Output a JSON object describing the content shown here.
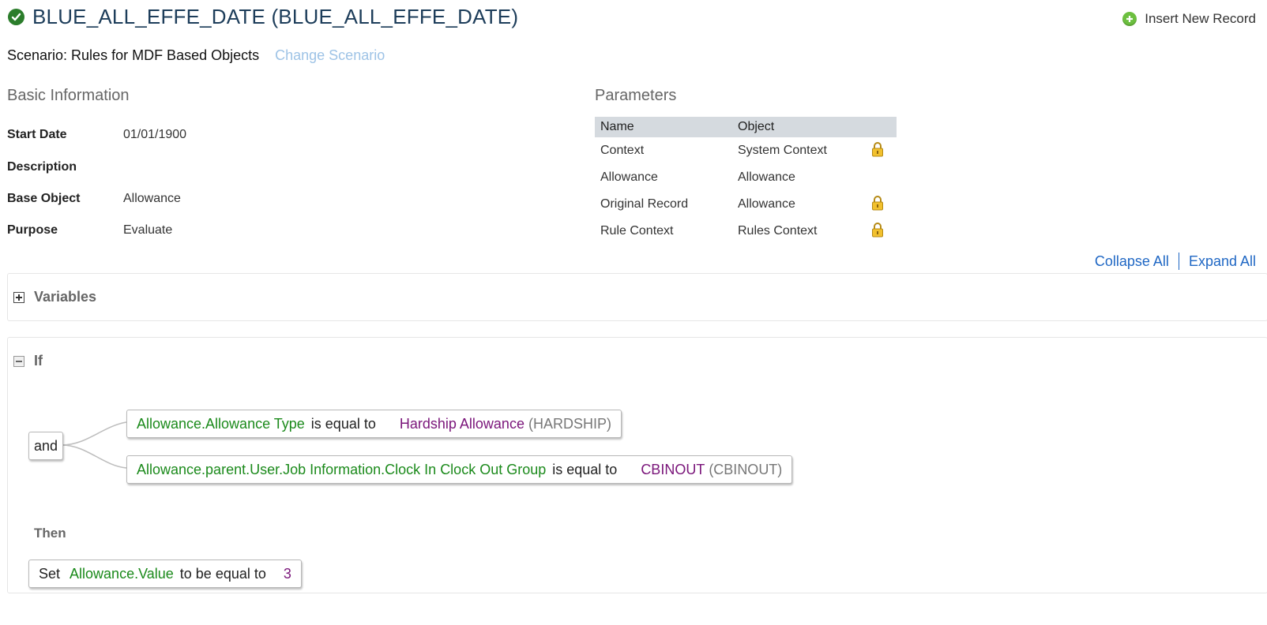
{
  "header": {
    "title": "BLUE_ALL_EFFE_DATE (BLUE_ALL_EFFE_DATE)",
    "status_icon": "check-circle-icon",
    "insert_label": "Insert New Record"
  },
  "scenario": {
    "label": "Scenario: Rules for MDF Based Objects",
    "change_label": "Change Scenario"
  },
  "basic_info": {
    "title": "Basic Information",
    "rows": [
      {
        "label": "Start Date",
        "value": "01/01/1900"
      },
      {
        "label": "Description",
        "value": ""
      },
      {
        "label": "Base Object",
        "value": "Allowance"
      },
      {
        "label": "Purpose",
        "value": "Evaluate"
      }
    ]
  },
  "parameters": {
    "title": "Parameters",
    "headers": [
      "Name",
      "Object"
    ],
    "rows": [
      {
        "name": "Context",
        "object": "System Context",
        "locked": true
      },
      {
        "name": "Allowance",
        "object": "Allowance",
        "locked": false
      },
      {
        "name": "Original Record",
        "object": "Allowance",
        "locked": true
      },
      {
        "name": "Rule Context",
        "object": "Rules Context",
        "locked": true
      }
    ]
  },
  "links": {
    "collapse": "Collapse All",
    "expand": "Expand All"
  },
  "variables": {
    "title": "Variables"
  },
  "if_section": {
    "title": "If",
    "operator": "and",
    "conditions": [
      {
        "field": "Allowance.Allowance Type",
        "op": "is equal to",
        "value": "Hardship Allowance",
        "code": "(HARDSHIP)"
      },
      {
        "field": "Allowance.parent.User.Job Information.Clock In Clock Out Group",
        "op": "is equal to",
        "value": "CBINOUT",
        "code": "(CBINOUT)"
      }
    ]
  },
  "then_section": {
    "title": "Then",
    "action": {
      "verb": "Set",
      "field": "Allowance.Value",
      "op": "to be equal to",
      "value": "3"
    }
  },
  "colors": {
    "field_green": "#1b8a1b",
    "value_purple": "#7a157a",
    "link_blue": "#1f67c4",
    "title_navy": "#1d3d5a"
  }
}
